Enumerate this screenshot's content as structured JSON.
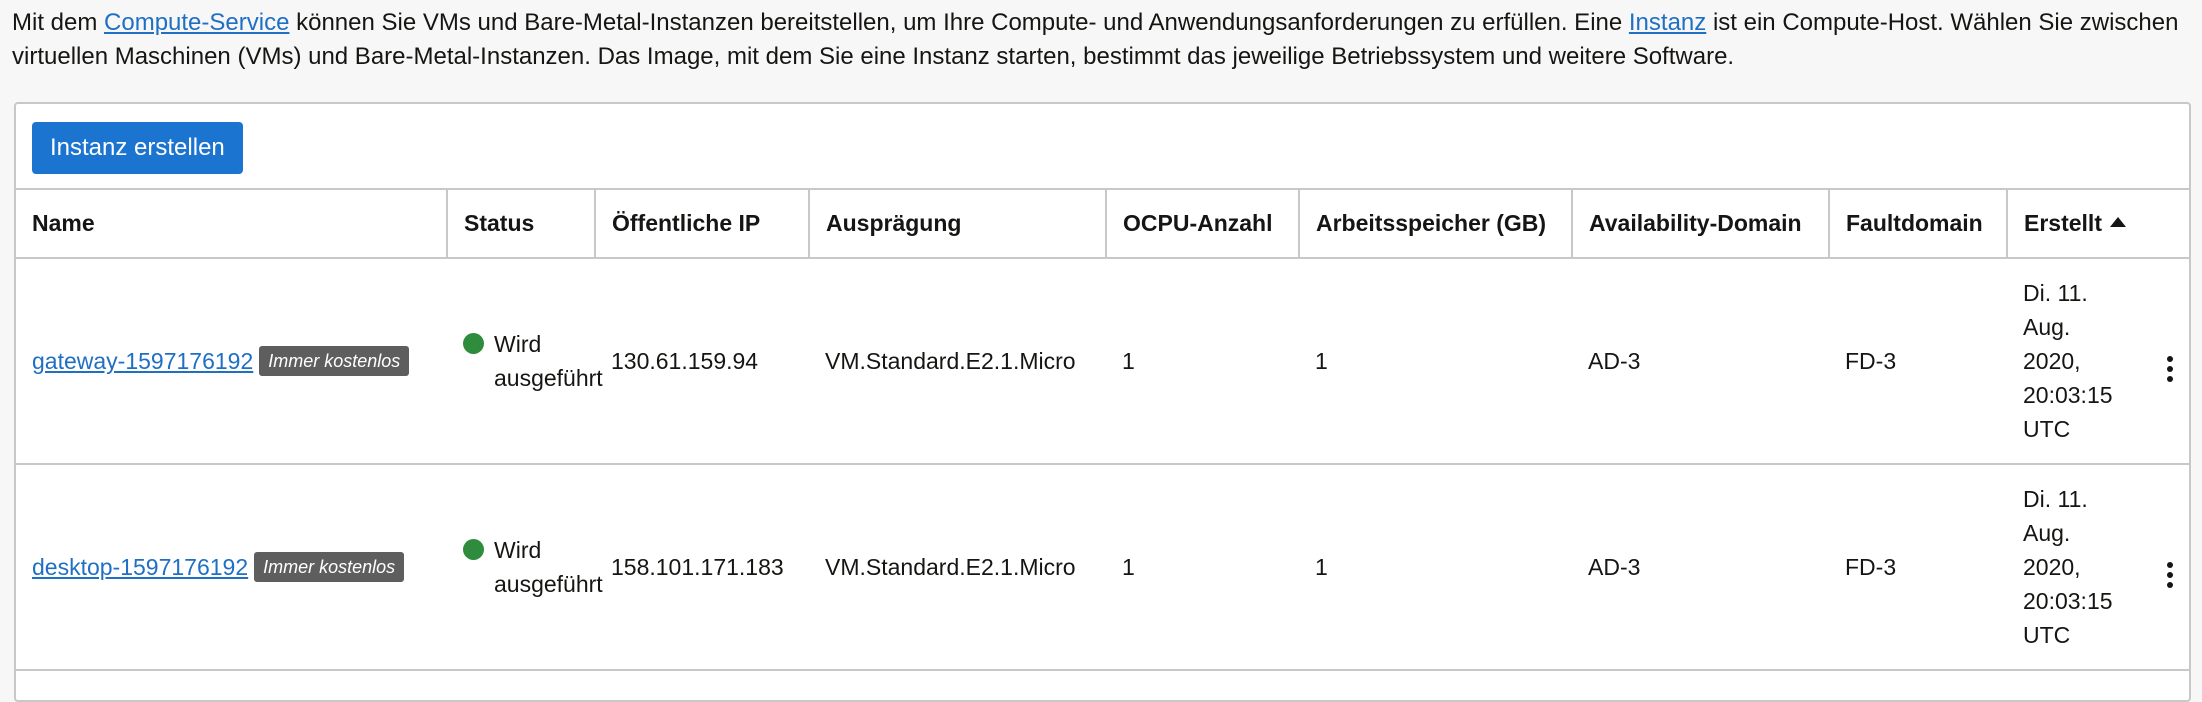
{
  "intro": {
    "text_1": "Mit dem ",
    "link_compute": "Compute-Service",
    "text_2": " können Sie VMs und Bare-Metal-Instanzen bereitstellen, um Ihre Compute- und Anwendungsanforderungen zu erfüllen. Eine ",
    "link_instanz": "Instanz",
    "text_3": " ist ein Compute-Host. Wählen Sie zwischen virtuellen Maschinen (VMs) und Bare-Metal-Instanzen. Das Image, mit dem Sie eine Instanz starten, bestimmt das jeweilige Betriebssystem und weitere Software."
  },
  "toolbar": {
    "create_label": "Instanz erstellen"
  },
  "table": {
    "columns": [
      "Name",
      "Status",
      "Öffentliche IP",
      "Ausprägung",
      "OCPU-Anzahl",
      "Arbeitsspeicher (GB)",
      "Availability-Domain",
      "Faultdomain",
      "Erstellt"
    ],
    "rows": [
      {
        "name": "gateway-1597176192",
        "badge": "Immer kostenlos",
        "status_1": "Wird",
        "status_2": "ausgeführt",
        "ip": "130.61.159.94",
        "shape": "VM.Standard.E2.1.Micro",
        "ocpu": "1",
        "memory": "1",
        "ad": "AD-3",
        "fd": "FD-3",
        "created_1": "Di. 11.",
        "created_2": "Aug.",
        "created_3": "2020,",
        "created_4": "20:03:15",
        "created_5": "UTC"
      },
      {
        "name": "desktop-1597176192",
        "badge": "Immer kostenlos",
        "status_1": "Wird",
        "status_2": "ausgeführt",
        "ip": "158.101.171.183",
        "shape": "VM.Standard.E2.1.Micro",
        "ocpu": "1",
        "memory": "1",
        "ad": "AD-3",
        "fd": "FD-3",
        "created_1": "Di. 11.",
        "created_2": "Aug.",
        "created_3": "2020,",
        "created_4": "20:03:15",
        "created_5": "UTC"
      }
    ]
  },
  "colors": {
    "link": "#1f6fc5",
    "button": "#1c74d1",
    "status_running": "#2e8c3c",
    "badge": "#5e5e5e"
  },
  "icons": {
    "status": "running-dot-icon",
    "sort": "sort-ascending-icon",
    "actions": "kebab-menu-icon"
  }
}
